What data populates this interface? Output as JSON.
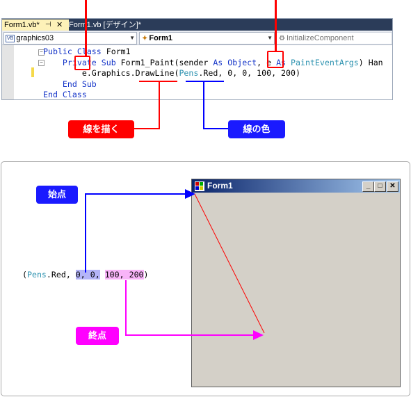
{
  "editor": {
    "tab_active": "Form1.vb*",
    "tab_pin": "⊣",
    "tab_close": "✕",
    "tab_design": "Form1.vb [デザイン]*",
    "class_combo": "graphics03",
    "class_badge": "VB",
    "member_combo": "Form1",
    "method_combo": "InitializeComponent",
    "code": {
      "line1_kw": "Public Class",
      "line1_rest": " Form1",
      "line2_kw1": "    Private Sub",
      "line2_name": " Form1_Paint(sender ",
      "line2_as1": "As",
      "line2_sp": " ",
      "line2_type1": "Object",
      "line2_comma": ", e ",
      "line2_as2": "As",
      "line2_type2": " PaintEventArgs",
      "line2_tail": ") Han",
      "line3_pre": "        e.Graphics.DrawLine(",
      "line3_pens": "Pens",
      "line3_rest": ".Red, 0, 0, 100, 200)",
      "line4_kw": "    End Sub",
      "line5_kw": "End Class"
    }
  },
  "callouts": {
    "draw_line": "線を描く",
    "line_color": "線の色",
    "start_point": "始点",
    "end_point": "終点"
  },
  "form_window": {
    "title": "Form1",
    "min_btn": "_",
    "max_btn": "□",
    "close_btn": "✕"
  },
  "args": {
    "open": "(",
    "pens": "Pens",
    "red": ".Red, ",
    "start": "0, 0,",
    "sep": " ",
    "end": "100, 200",
    "close": ")"
  },
  "colors": {
    "red": "#ff0000",
    "blue": "#0000ff",
    "magenta": "#ff00ff",
    "window_bg": "#d4d0c8",
    "title_start": "#0a246a",
    "title_end": "#a6caf0"
  }
}
